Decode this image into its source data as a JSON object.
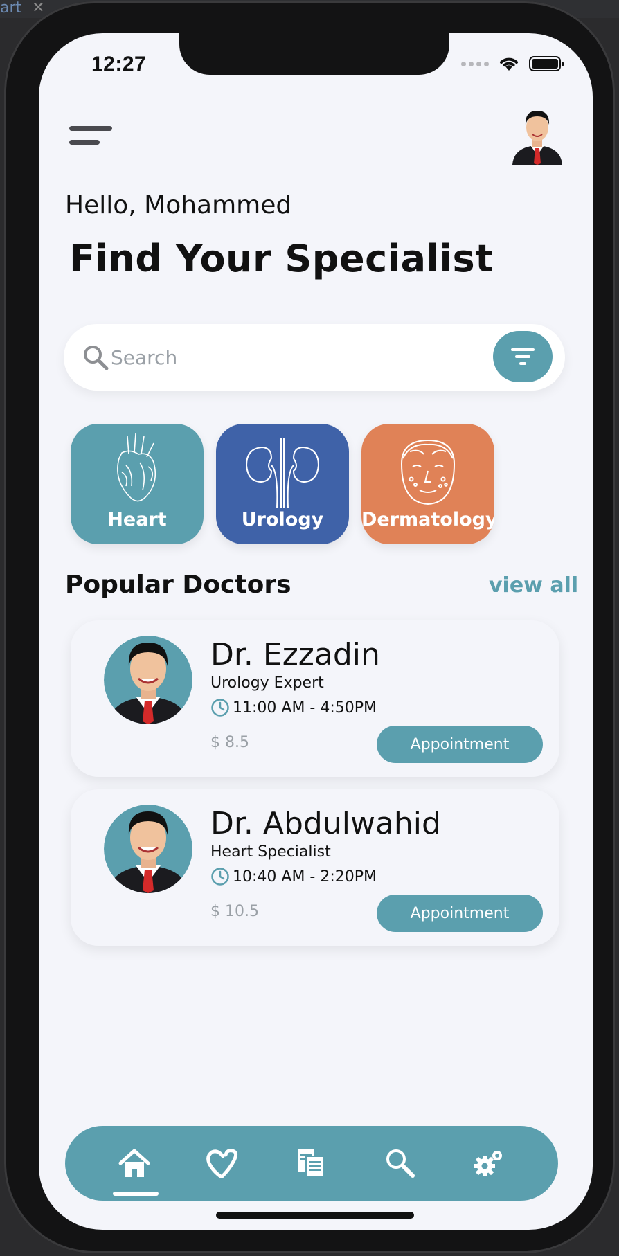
{
  "ide": {
    "tab_label": "art",
    "close_glyph": "✕"
  },
  "status_bar": {
    "time": "12:27"
  },
  "header": {
    "greeting": "Hello, Mohammed",
    "title": "Find Your Specialist"
  },
  "search": {
    "placeholder": "Search"
  },
  "categories": [
    {
      "label": "Heart",
      "color": "#5b9fae",
      "icon": "heart-anatomy-icon"
    },
    {
      "label": "Urology",
      "color": "#3f62a8",
      "icon": "kidneys-icon"
    },
    {
      "label": "Dermatology",
      "color": "#e08257",
      "icon": "face-skin-icon"
    }
  ],
  "popular": {
    "title": "Popular Doctors",
    "view_all": "view all"
  },
  "doctors": [
    {
      "name": "Dr. Ezzadin",
      "specialty": "Urology Expert",
      "hours": "11:00 AM - 4:50PM",
      "price": "$ 8.5",
      "button": "Appointment"
    },
    {
      "name": "Dr. Abdulwahid",
      "specialty": "Heart Specialist",
      "hours": "10:40 AM - 2:20PM",
      "price": "$ 10.5",
      "button": "Appointment"
    }
  ],
  "nav": {
    "items": [
      {
        "icon": "home-icon",
        "active": true
      },
      {
        "icon": "heart-outline-icon",
        "active": false
      },
      {
        "icon": "documents-icon",
        "active": false
      },
      {
        "icon": "search-icon",
        "active": false
      },
      {
        "icon": "settings-gears-icon",
        "active": false
      }
    ]
  },
  "colors": {
    "accent": "#5b9fae",
    "background": "#f4f5fa",
    "urology": "#3f62a8",
    "dermatology": "#e08257"
  }
}
